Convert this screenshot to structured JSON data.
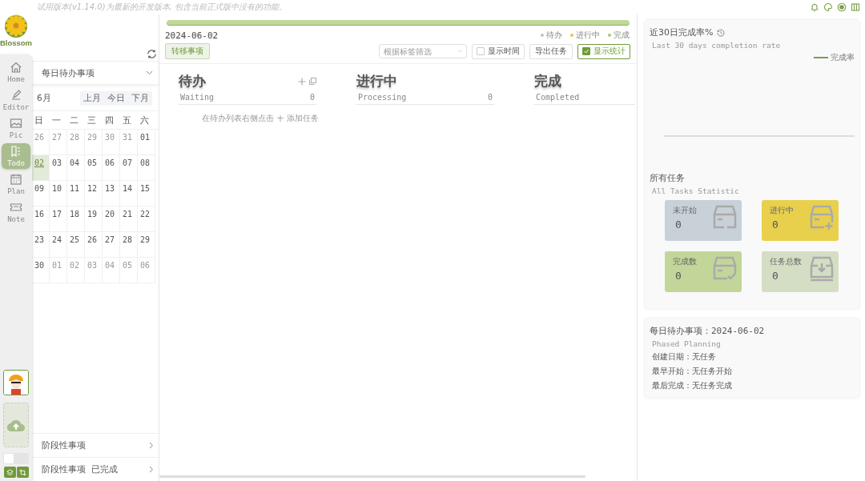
{
  "banner": "试用版本(v1.14.0)为最新的开发版本, 包含当前正式版中没有的功能。",
  "rail": {
    "logo": "Blossom",
    "items": [
      {
        "label": "Home",
        "selected": false
      },
      {
        "label": "Editor",
        "selected": false
      },
      {
        "label": "Pic",
        "selected": false
      },
      {
        "label": "Todo",
        "selected": true
      },
      {
        "label": "Plan",
        "selected": false
      },
      {
        "label": "Note",
        "selected": false
      }
    ],
    "theme_switch": {
      "on": false
    }
  },
  "list_selector": "每日待办事项",
  "calendar": {
    "month": "6月",
    "nav": [
      "上月",
      "今日",
      "下月"
    ],
    "weekdays": [
      "日",
      "一",
      "二",
      "三",
      "四",
      "五",
      "六"
    ],
    "weeks": [
      [
        {
          "day": "26",
          "outside": true,
          "selected": false
        },
        {
          "day": "27",
          "outside": true,
          "selected": false
        },
        {
          "day": "28",
          "outside": true,
          "selected": false
        },
        {
          "day": "29",
          "outside": true,
          "selected": false
        },
        {
          "day": "30",
          "outside": true,
          "selected": false
        },
        {
          "day": "31",
          "outside": true,
          "selected": false
        },
        {
          "day": "01",
          "outside": false,
          "selected": false
        }
      ],
      [
        {
          "day": "02",
          "outside": false,
          "selected": true
        },
        {
          "day": "03",
          "outside": false,
          "selected": false
        },
        {
          "day": "04",
          "outside": false,
          "selected": false
        },
        {
          "day": "05",
          "outside": false,
          "selected": false
        },
        {
          "day": "06",
          "outside": false,
          "selected": false
        },
        {
          "day": "07",
          "outside": false,
          "selected": false
        },
        {
          "day": "08",
          "outside": false,
          "selected": false
        }
      ],
      [
        {
          "day": "09",
          "outside": false,
          "selected": false
        },
        {
          "day": "10",
          "outside": false,
          "selected": false
        },
        {
          "day": "11",
          "outside": false,
          "selected": false
        },
        {
          "day": "12",
          "outside": false,
          "selected": false
        },
        {
          "day": "13",
          "outside": false,
          "selected": false
        },
        {
          "day": "14",
          "outside": false,
          "selected": false
        },
        {
          "day": "15",
          "outside": false,
          "selected": false
        }
      ],
      [
        {
          "day": "16",
          "outside": false,
          "selected": false
        },
        {
          "day": "17",
          "outside": false,
          "selected": false
        },
        {
          "day": "18",
          "outside": false,
          "selected": false
        },
        {
          "day": "19",
          "outside": false,
          "selected": false
        },
        {
          "day": "20",
          "outside": false,
          "selected": false
        },
        {
          "day": "21",
          "outside": false,
          "selected": false
        },
        {
          "day": "22",
          "outside": false,
          "selected": false
        }
      ],
      [
        {
          "day": "23",
          "outside": false,
          "selected": false
        },
        {
          "day": "24",
          "outside": false,
          "selected": false
        },
        {
          "day": "25",
          "outside": false,
          "selected": false
        },
        {
          "day": "26",
          "outside": false,
          "selected": false
        },
        {
          "day": "27",
          "outside": false,
          "selected": false
        },
        {
          "day": "28",
          "outside": false,
          "selected": false
        },
        {
          "day": "29",
          "outside": false,
          "selected": false
        }
      ],
      [
        {
          "day": "30",
          "outside": false,
          "selected": false
        },
        {
          "day": "01",
          "outside": true,
          "selected": false
        },
        {
          "day": "02",
          "outside": true,
          "selected": false
        },
        {
          "day": "03",
          "outside": true,
          "selected": false
        },
        {
          "day": "04",
          "outside": true,
          "selected": false
        },
        {
          "day": "05",
          "outside": true,
          "selected": false
        },
        {
          "day": "06",
          "outside": true,
          "selected": false
        }
      ]
    ]
  },
  "phase_items": [
    {
      "label": "阶段性事项"
    },
    {
      "label": "阶段性事项",
      "tag": "已完成"
    }
  ],
  "board": {
    "progress": {
      "level": 1
    },
    "date": "2024-06-02",
    "legend": [
      {
        "label": "待办",
        "color": "#b9c4cc"
      },
      {
        "label": "进行中",
        "color": "#e8c840"
      },
      {
        "label": "完成",
        "color": "#a8c884"
      }
    ],
    "transfer_button": "转移事项",
    "tag_filter": {
      "placeholder": "根据标签筛选"
    },
    "show_time": {
      "label": "显示时间",
      "checked": false
    },
    "export_button": "导出任务",
    "show_stats": {
      "label": "显示统计",
      "checked": true
    },
    "columns": [
      {
        "title": "待办",
        "subtitle": "Waiting",
        "count": "0",
        "actions": true
      },
      {
        "title": "进行中",
        "subtitle": "Processing",
        "count": "0",
        "actions": false
      },
      {
        "title": "完成",
        "subtitle": "Completed",
        "actions": false
      }
    ],
    "hint_before": "在待办列表右侧点击",
    "hint_icon": "+",
    "hint_after": "添加任务"
  },
  "rate_card": {
    "title": "近30日完成率%",
    "subtitle": "Last 30 days completion rate",
    "legend": "完成率"
  },
  "stats": {
    "title": "所有任务",
    "subtitle": "All Tasks Statistic",
    "cards": [
      {
        "label": "未开始",
        "value": "0",
        "kind": "minus",
        "color": "#c8d0d8"
      },
      {
        "label": "进行中",
        "value": "0",
        "kind": "plus",
        "color": "#e8d04c"
      },
      {
        "label": "完成数",
        "value": "0",
        "kind": "check",
        "color": "#c2d69a"
      },
      {
        "label": "任务总数",
        "value": "0",
        "kind": "download",
        "color": "#d4dec4"
      }
    ]
  },
  "detail": {
    "title": "每日待办事项：2024-06-02",
    "subtitle": "Phased Planning",
    "lines": [
      "创建日期：无任务",
      "最早开始：无任务开始",
      "最后完成：无任务完成"
    ]
  }
}
